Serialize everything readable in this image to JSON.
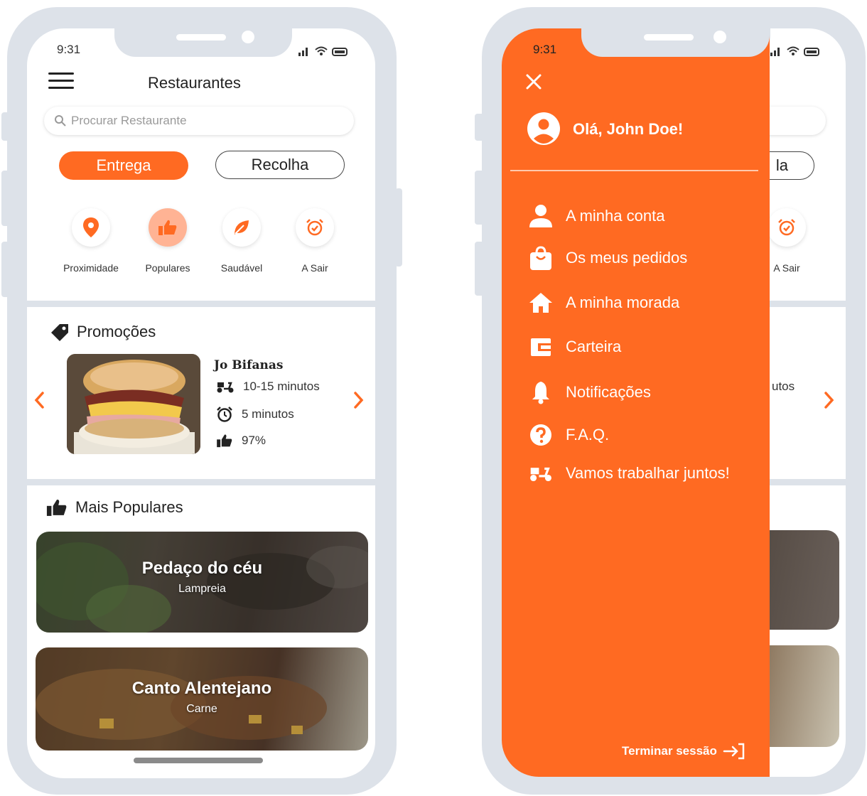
{
  "colors": {
    "accent": "#ff6a22",
    "frame": "#dde2e9",
    "text": "#222222"
  },
  "status": {
    "time": "9:31",
    "icons": "signal wifi battery"
  },
  "home": {
    "title": "Restaurantes",
    "search_placeholder": "Procurar Restaurante",
    "tabs": {
      "delivery": "Entrega",
      "pickup": "Recolha"
    },
    "categories": [
      {
        "label": "Proximidade",
        "icon": "location-pin-icon"
      },
      {
        "label": "Populares",
        "icon": "thumbs-up-icon"
      },
      {
        "label": "Saudável",
        "icon": "leaf-icon"
      },
      {
        "label": "A Sair",
        "icon": "alarm-clock-icon"
      }
    ],
    "promotions": {
      "title": "Promoções",
      "restaurant": "Jo Bifanas",
      "delivery_time": "10-15 minutos",
      "prep_time": "5 minutos",
      "rating": "97%"
    },
    "popular": {
      "title": "Mais Populares",
      "items": [
        {
          "name": "Pedaço do céu",
          "category": "Lampreia"
        },
        {
          "name": "Canto Alentejano",
          "category": "Carne"
        }
      ]
    }
  },
  "menu": {
    "greeting": "Olá, John Doe!",
    "items": [
      {
        "label": "A minha conta",
        "icon": "user-icon"
      },
      {
        "label": "Os meus pedidos",
        "icon": "shopping-bag-icon"
      },
      {
        "label": "A minha morada",
        "icon": "home-icon"
      },
      {
        "label": "Carteira",
        "icon": "wallet-icon"
      },
      {
        "label": "Notificações",
        "icon": "bell-icon"
      },
      {
        "label": "F.A.Q.",
        "icon": "question-icon"
      },
      {
        "label": "Vamos trabalhar juntos!",
        "icon": "scooter-icon"
      }
    ],
    "logout": "Terminar sessão"
  },
  "behind": {
    "pickup_partial": "la",
    "category_label": "A Sair",
    "minutes_partial": "utos"
  }
}
